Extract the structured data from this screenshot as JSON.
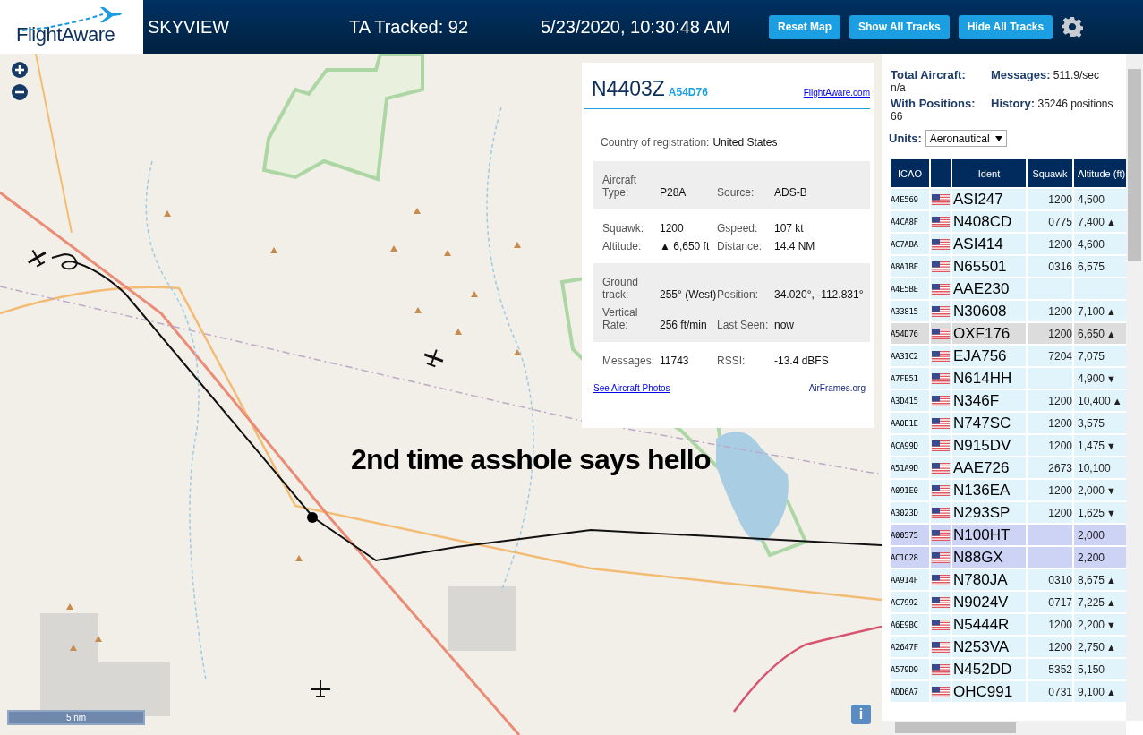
{
  "header": {
    "logo": "FlightAware",
    "title": "SKYVIEW",
    "tracked": "TA Tracked: 92",
    "datetime": "5/23/2020, 10:30:48 AM",
    "buttons": [
      "Reset Map",
      "Show All Tracks",
      "Hide All Tracks"
    ]
  },
  "map": {
    "scale": "5 nm",
    "info_button": "i",
    "caption": "2nd time asshole says hello"
  },
  "popup": {
    "ident": "N4403Z",
    "hex": "A54D76",
    "link": "FlightAware.com",
    "country_label": "Country of registration:",
    "country": "United States",
    "sections": [
      {
        "shaded": true,
        "fields": [
          {
            "label": "Aircraft Type:",
            "value": "P28A"
          },
          {
            "label": "Source:",
            "value": "ADS-B"
          }
        ]
      },
      {
        "shaded": false,
        "fields": [
          {
            "label": "Squawk:",
            "value": "1200"
          },
          {
            "label": "Gspeed:",
            "value": "107 kt"
          },
          {
            "label": "Altitude:",
            "value": "▲ 6,650 ft"
          },
          {
            "label": "Distance:",
            "value": "14.4 NM"
          }
        ]
      },
      {
        "shaded": true,
        "fields": [
          {
            "label": "Ground track:",
            "value": "255° (West)"
          },
          {
            "label": "Position:",
            "value": "34.020°, -112.831°"
          },
          {
            "label": "Vertical Rate:",
            "value": "256 ft/min"
          },
          {
            "label": "Last Seen:",
            "value": "now"
          }
        ]
      },
      {
        "shaded": false,
        "fields": [
          {
            "label": "Messages:",
            "value": "11743"
          },
          {
            "label": "RSSI:",
            "value": "-13.4 dBFS"
          }
        ]
      }
    ],
    "photos_link": "See Aircraft Photos",
    "airframes_link": "AirFrames.org"
  },
  "stats": [
    {
      "label": "Total Aircraft:",
      "value": "n/a"
    },
    {
      "label": "Messages:",
      "value": "511.9/sec"
    },
    {
      "label": "With Positions:",
      "value": "66"
    },
    {
      "label": "History:",
      "value": "35246 positions"
    }
  ],
  "units": {
    "label": "Units:",
    "value": "Aeronautical"
  },
  "table": {
    "columns": [
      "ICAO",
      "Ident",
      "Squawk",
      "Altitude (ft)"
    ],
    "rows": [
      {
        "icao": "A4E569",
        "ident": "ASI247",
        "squawk": "1200",
        "altitude": "4,500",
        "selected": false,
        "kind": "adsb"
      },
      {
        "icao": "A4CA8F",
        "ident": "N408CD",
        "squawk": "0775",
        "altitude": "7,400",
        "trend": "▲",
        "selected": false,
        "kind": "adsb"
      },
      {
        "icao": "AC7ABA",
        "ident": "ASI414",
        "squawk": "1200",
        "altitude": "4,600",
        "selected": false,
        "kind": "adsb"
      },
      {
        "icao": "A8A1BF",
        "ident": "N65501",
        "squawk": "0316",
        "altitude": "6,575",
        "selected": false,
        "kind": "adsb"
      },
      {
        "icao": "A4E5BE",
        "ident": "AAE230",
        "selected": false,
        "kind": "adsb"
      },
      {
        "icao": "A33815",
        "ident": "N30608",
        "squawk": "1200",
        "altitude": "7,100",
        "trend": "▲",
        "selected": false,
        "kind": "adsb"
      },
      {
        "icao": "A54D76",
        "ident": "OXF176",
        "squawk": "1200",
        "altitude": "6,650",
        "trend": "▲",
        "selected": true,
        "kind": "adsb"
      },
      {
        "icao": "AA31C2",
        "ident": "EJA756",
        "squawk": "7204",
        "altitude": "7,075",
        "selected": false,
        "kind": "adsb"
      },
      {
        "icao": "A7FE51",
        "ident": "N614HH",
        "altitude": "4,900",
        "trend": "▼",
        "selected": false,
        "kind": "adsb"
      },
      {
        "icao": "A3D415",
        "ident": "N346F",
        "squawk": "1200",
        "altitude": "10,400",
        "trend": "▲",
        "selected": false,
        "kind": "adsb"
      },
      {
        "icao": "AA0E1E",
        "ident": "N747SC",
        "squawk": "1200",
        "altitude": "3,575",
        "selected": false,
        "kind": "adsb"
      },
      {
        "icao": "ACA99D",
        "ident": "N915DV",
        "squawk": "1200",
        "altitude": "1,475",
        "trend": "▼",
        "selected": false,
        "kind": "adsb"
      },
      {
        "icao": "A51A9D",
        "ident": "AAE726",
        "squawk": "2673",
        "altitude": "10,100",
        "selected": false,
        "kind": "adsb"
      },
      {
        "icao": "A091E0",
        "ident": "N136EA",
        "squawk": "1200",
        "altitude": "2,000",
        "trend": "▼",
        "selected": false,
        "kind": "adsb"
      },
      {
        "icao": "A3023D",
        "ident": "N293SP",
        "squawk": "1200",
        "altitude": "1,625",
        "trend": "▼",
        "selected": false,
        "kind": "adsb"
      },
      {
        "icao": "A00575",
        "ident": "N100HT",
        "altitude": "2,000",
        "selected": false,
        "kind": "mlat"
      },
      {
        "icao": "AC1C28",
        "ident": "N88GX",
        "altitude": "2,200",
        "selected": false,
        "kind": "mlat"
      },
      {
        "icao": "AA914F",
        "ident": "N780JA",
        "squawk": "0310",
        "altitude": "8,675",
        "trend": "▲",
        "selected": false,
        "kind": "adsb"
      },
      {
        "icao": "AC7992",
        "ident": "N9024V",
        "squawk": "0717",
        "altitude": "7,225",
        "trend": "▲",
        "selected": false,
        "kind": "adsb"
      },
      {
        "icao": "A6E9BC",
        "ident": "N5444R",
        "squawk": "1200",
        "altitude": "2,200",
        "trend": "▼",
        "selected": false,
        "kind": "adsb"
      },
      {
        "icao": "A2647F",
        "ident": "N253VA",
        "squawk": "1200",
        "altitude": "2,750",
        "trend": "▲",
        "selected": false,
        "kind": "adsb"
      },
      {
        "icao": "A579D9",
        "ident": "N452DD",
        "squawk": "5352",
        "altitude": "5,150",
        "selected": false,
        "kind": "adsb"
      },
      {
        "icao": "ADD6A7",
        "ident": "OHC991",
        "squawk": "0731",
        "altitude": "9,100",
        "trend": "▲",
        "selected": false,
        "kind": "adsb"
      }
    ]
  }
}
